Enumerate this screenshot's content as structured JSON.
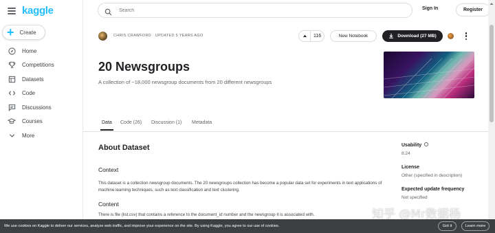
{
  "brand": {
    "logo": "kaggle"
  },
  "sidebar": {
    "create_label": "Create",
    "items": [
      {
        "label": "Home",
        "icon": "compass-icon"
      },
      {
        "label": "Competitions",
        "icon": "trophy-icon"
      },
      {
        "label": "Datasets",
        "icon": "table-icon"
      },
      {
        "label": "Code",
        "icon": "code-icon"
      },
      {
        "label": "Discussions",
        "icon": "comment-icon"
      },
      {
        "label": "Courses",
        "icon": "graduation-cap-icon"
      },
      {
        "label": "More",
        "icon": "chevron-down-icon"
      }
    ]
  },
  "topbar": {
    "search_placeholder": "Search",
    "signin_label": "Sign In",
    "register_label": "Register"
  },
  "dataset": {
    "byline": "CHRIS CRAWFORD · UPDATED 5 YEARS AGO",
    "votes": "116",
    "new_notebook_label": "New Notebook",
    "download_label": "Download (27 MB)",
    "title": "20 Newsgroups",
    "subtitle": "A collection of ~18,000 newsgroup documents from 20 different newsgroups"
  },
  "tabs": [
    {
      "label": "Data",
      "active": true
    },
    {
      "label": "Code (26)",
      "active": false
    },
    {
      "label": "Discussion (1)",
      "active": false
    },
    {
      "label": "Metadata",
      "active": false
    }
  ],
  "about": {
    "heading": "About Dataset",
    "context_heading": "Context",
    "context_text": "This dataset is a collection newsgroup documents. The 20 newsgroups collection has become a popular data set for experiments in text applications of machine learning techniques, such as text classification and text clustering.",
    "content_heading": "Content",
    "content_text": "There is file (list.csv) that contains a reference to the document_id number and the newsgroup it is associated with."
  },
  "meta": {
    "usability_label": "Usability",
    "usability_value": "8.24",
    "license_label": "License",
    "license_value": "Other (specified in description)",
    "frequency_label": "Expected update frequency",
    "frequency_value": "Not specified"
  },
  "watermark": "知乎 @Mr数据杨",
  "cookie": {
    "text": "We use cookies on Kaggle to deliver our services, analyze web traffic, and improve your experience on the site. By using Kaggle, you agree to our use of cookies.",
    "got_it_label": "Got it",
    "learn_more_label": "Learn more"
  },
  "colors": {
    "brand": "#20beff",
    "download_bg": "#202124",
    "cookie_bg": "#3c4043"
  }
}
